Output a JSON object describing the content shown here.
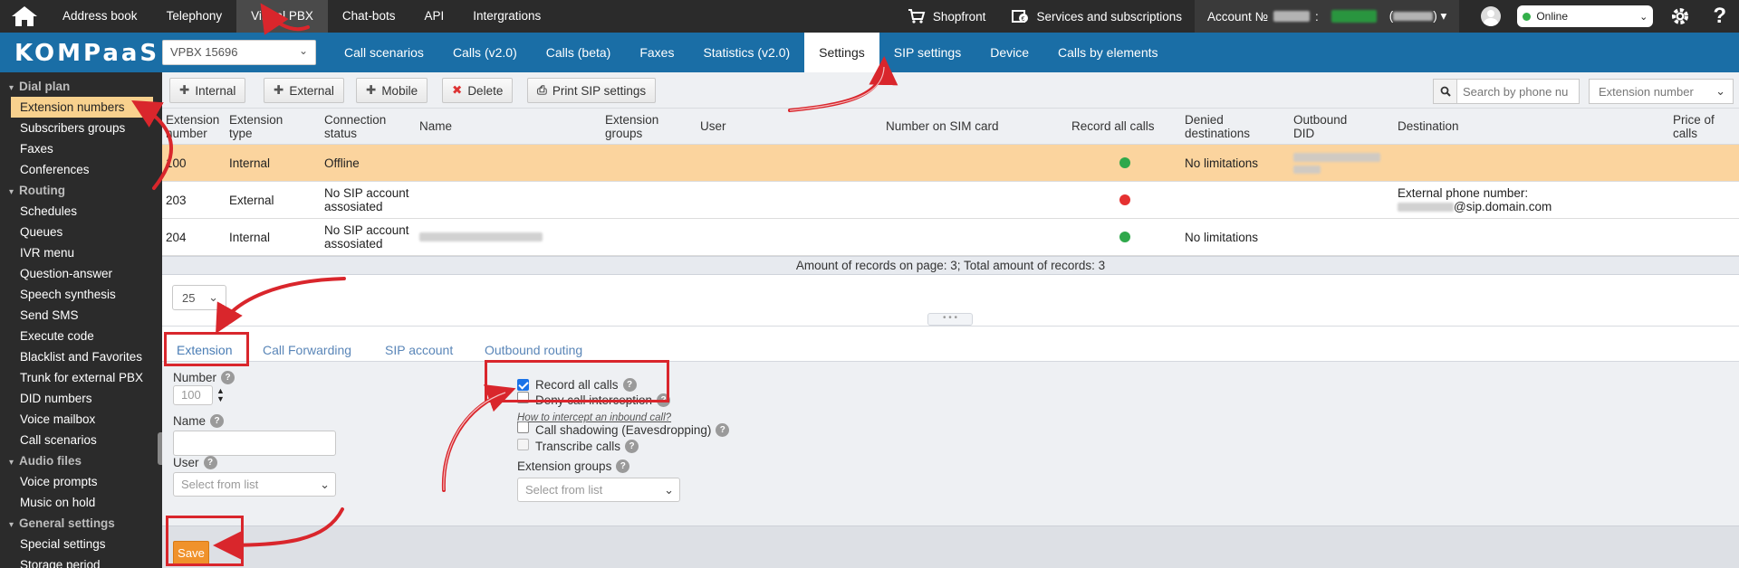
{
  "topbar": {
    "nav": [
      {
        "label": "Address book"
      },
      {
        "label": "Telephony"
      },
      {
        "label": "Virtual PBX"
      },
      {
        "label": "Chat-bots"
      },
      {
        "label": "API"
      },
      {
        "label": "Intergrations"
      }
    ],
    "shopfront": "Shopfront",
    "services": "Services and subscriptions",
    "account_prefix": "Account №",
    "status": "Online"
  },
  "secbar": {
    "logo": "KOMPaaS",
    "pbx_select": "VPBX 15696",
    "tabs": [
      {
        "label": "Call scenarios"
      },
      {
        "label": "Calls (v2.0)"
      },
      {
        "label": "Calls (beta)"
      },
      {
        "label": "Faxes"
      },
      {
        "label": "Statistics (v2.0)"
      },
      {
        "label": "Settings"
      },
      {
        "label": "SIP settings"
      },
      {
        "label": "Device"
      },
      {
        "label": "Calls by elements"
      }
    ]
  },
  "sidebar": {
    "groups": [
      {
        "title": "Dial plan",
        "items": [
          "Extension numbers",
          "Subscribers groups",
          "Faxes",
          "Conferences"
        ]
      },
      {
        "title": "Routing",
        "items": [
          "Schedules",
          "Queues",
          "IVR menu",
          "Question-answer",
          "Speech synthesis",
          "Send SMS",
          "Execute code",
          "Blacklist and Favorites",
          "Trunk for external PBX",
          "DID numbers",
          "Voice mailbox",
          "Call scenarios"
        ]
      },
      {
        "title": "Audio files",
        "items": [
          "Voice prompts",
          "Music on hold"
        ]
      },
      {
        "title": "General settings",
        "items": [
          "Special settings",
          "Storage period"
        ]
      }
    ]
  },
  "toolbar": {
    "internal": "Internal",
    "external": "External",
    "mobile": "Mobile",
    "delete": "Delete",
    "print": "Print SIP settings",
    "search_placeholder": "Search by phone nu",
    "ext_select": "Extension number"
  },
  "table": {
    "headers": [
      "Extension number",
      "Extension type",
      "Connection status",
      "Name",
      "Extension groups",
      "User",
      "Number on SIM card",
      "Record all calls",
      "Denied destinations",
      "Outbound DID",
      "Destination",
      "Price of calls"
    ],
    "rows": [
      {
        "number": "100",
        "type": "Internal",
        "status": "Offline",
        "record": "green",
        "denied": "No limitations",
        "destination": ""
      },
      {
        "number": "203",
        "type": "External",
        "status": "No SIP account assosiated",
        "record": "red",
        "denied": "",
        "destination": "External phone number:",
        "destination2": "@sip.domain.com"
      },
      {
        "number": "204",
        "type": "Internal",
        "status": "No SIP account assosiated",
        "record": "green",
        "denied": "No limitations",
        "destination": ""
      }
    ],
    "summary": "Amount of records on page: 3; Total amount of records: 3",
    "page_size": "25"
  },
  "detail": {
    "tabs": [
      "Extension",
      "Call Forwarding",
      "SIP account",
      "Outbound routing"
    ],
    "number_label": "Number",
    "number_placeholder": "100",
    "name_label": "Name",
    "user_label": "User",
    "user_placeholder": "Select from list",
    "record_all": "Record all calls",
    "deny_interception": "Deny call interception",
    "intercept_hint": "How to intercept an inbound call?",
    "shadowing": "Call shadowing (Eavesdropping)",
    "transcribe": "Transcribe calls",
    "groups_label": "Extension groups",
    "groups_placeholder": "Select from list",
    "save": "Save"
  },
  "colors": {
    "topbar": "#2b2b2b",
    "brand_blue": "#1a6ea6",
    "selected_row": "#fbd49e",
    "save_orange": "#f0922b",
    "annotation_red": "#d9262c"
  }
}
